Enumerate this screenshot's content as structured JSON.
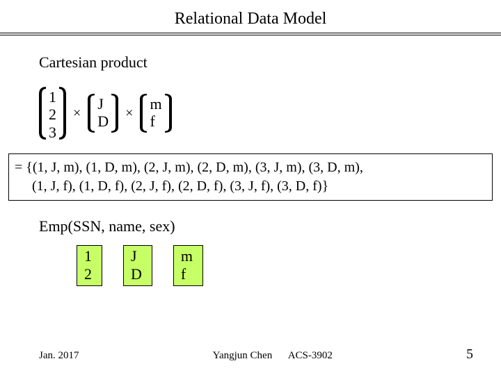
{
  "title": "Relational Data Model",
  "subtitle": "Cartesian product",
  "sets": {
    "a": [
      "1",
      "2",
      "3"
    ],
    "b": [
      "J",
      "D"
    ],
    "c": [
      "m",
      "f"
    ]
  },
  "times": "×",
  "result": {
    "line1": "= {(1, J, m), (1, D, m), (2, J, m), (2, D, m), (3, J, m), (3, D, m),",
    "line2": "     (1, J, f), (1, D, f), (2, J, f), (2, D, f), (3, J, f), (3, D, f)}"
  },
  "emp": "Emp(SSN, name, sex)",
  "tables": {
    "a": [
      "1",
      "2"
    ],
    "b": [
      "J",
      "D"
    ],
    "c": [
      "m",
      "f"
    ]
  },
  "footer": {
    "date": "Jan. 2017",
    "author_course": "Yangjun Chen      ACS-3902",
    "page": "5"
  }
}
